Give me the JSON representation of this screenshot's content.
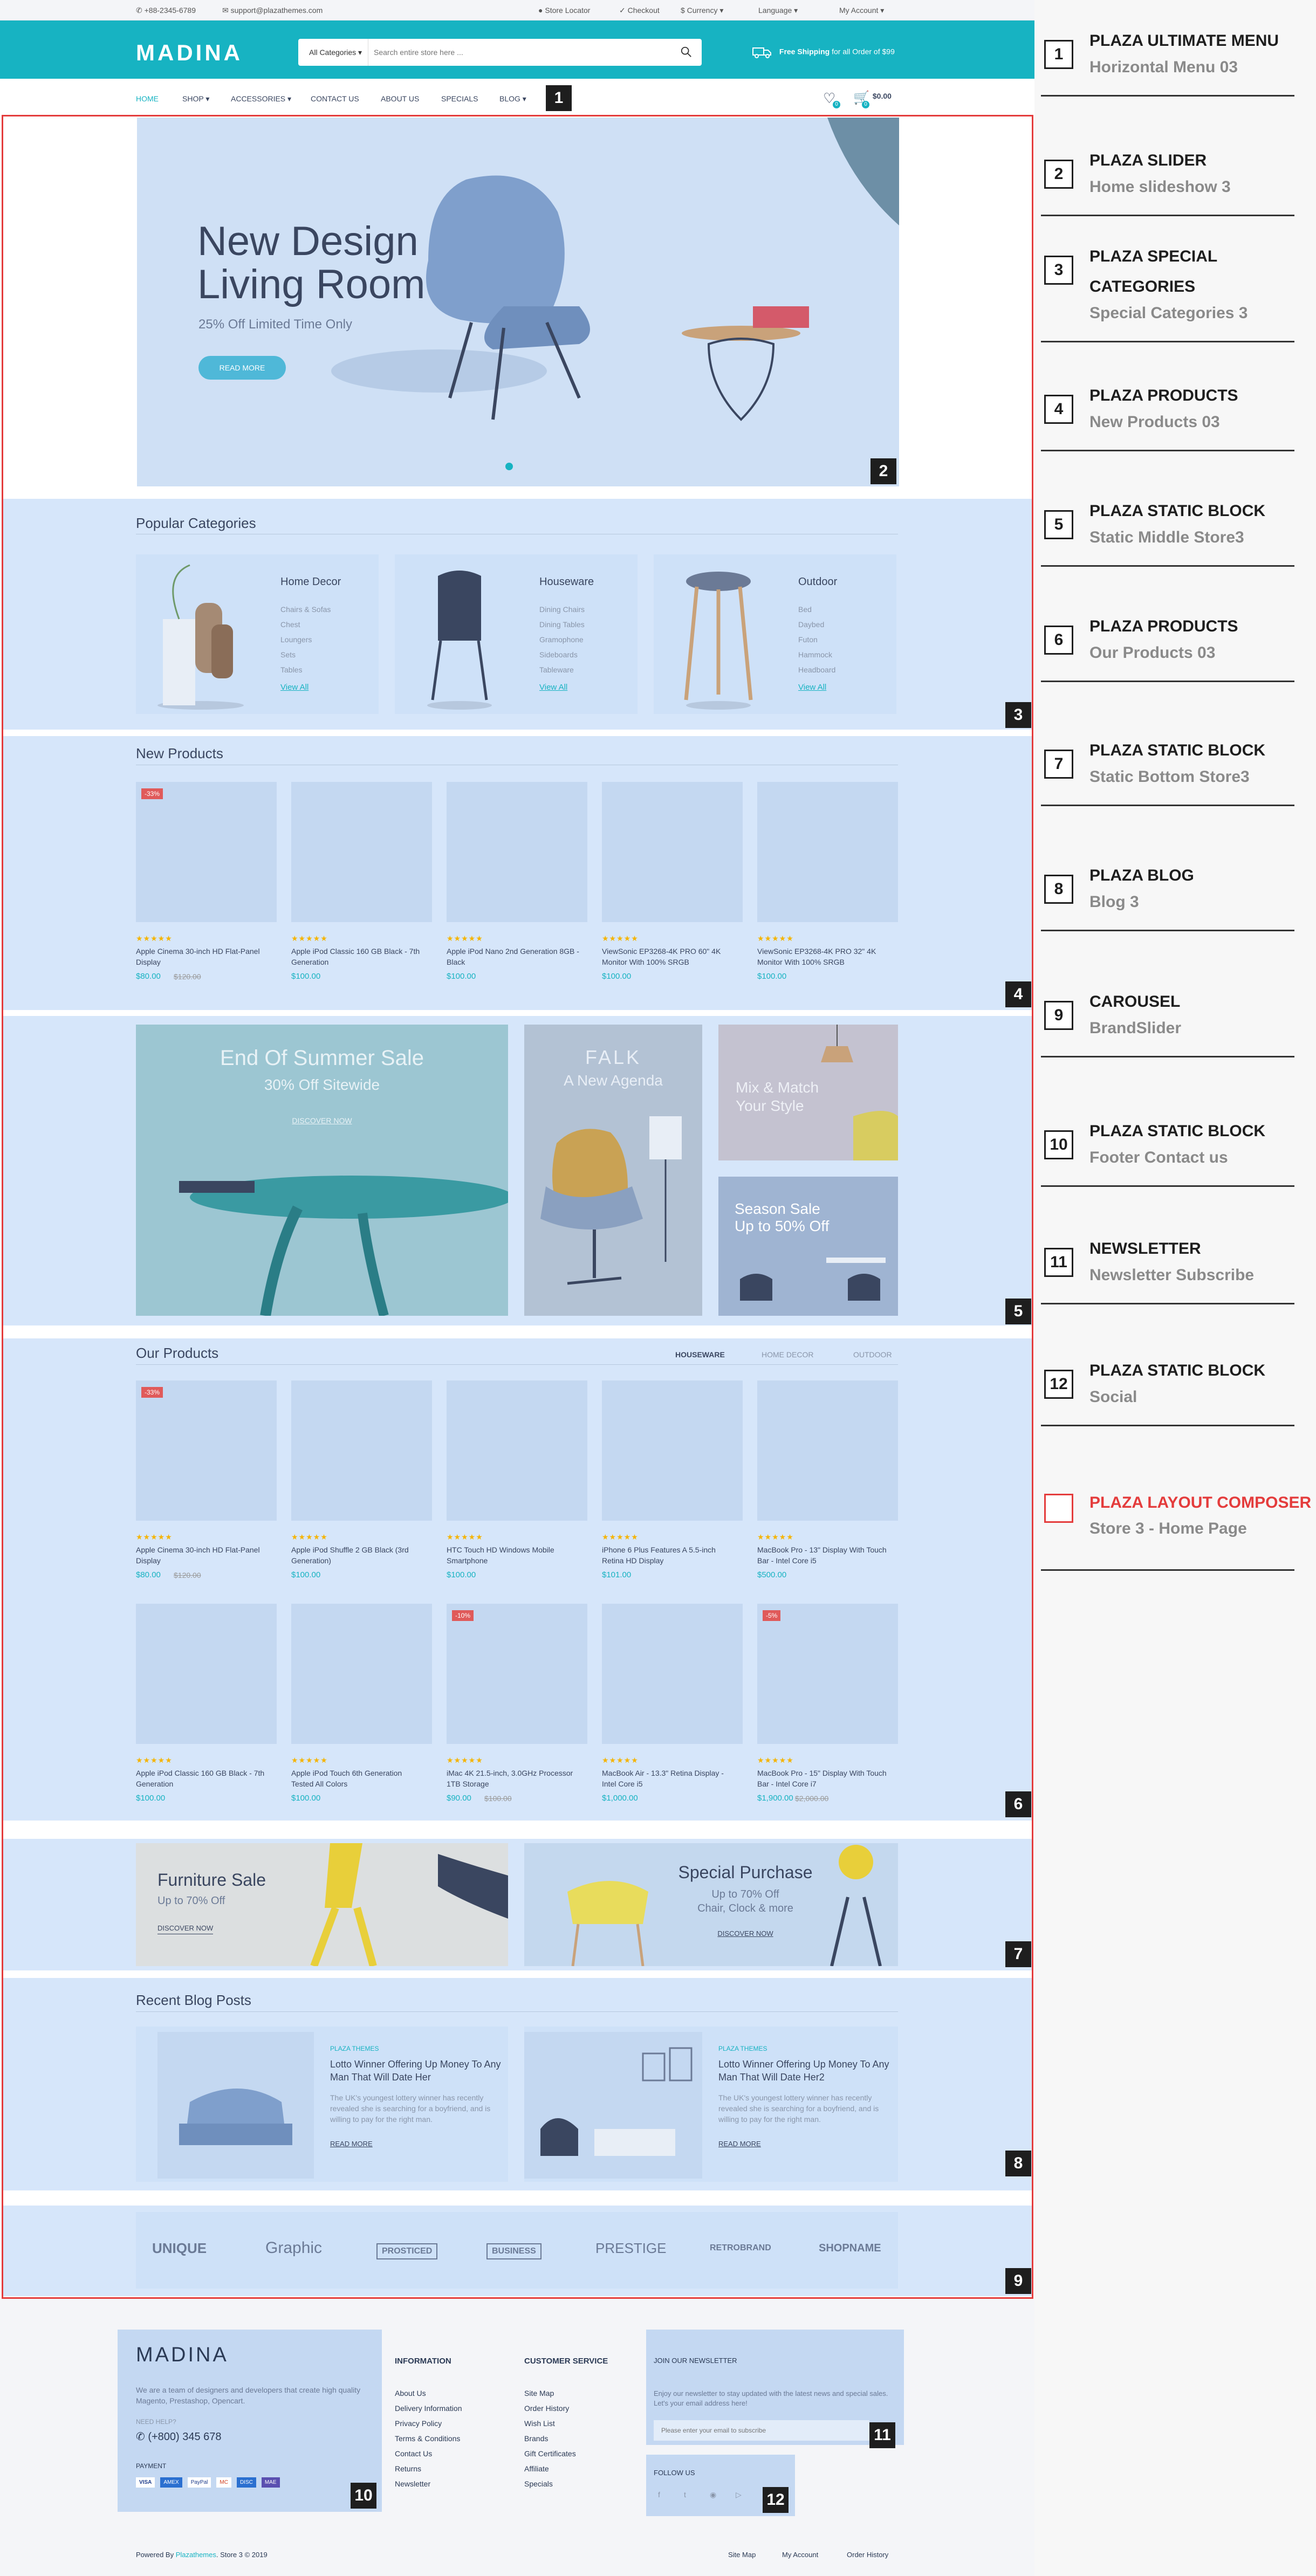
{
  "topbar": {
    "phone": "+88-2345-6789",
    "email": "support@plazathemes.com",
    "store_locator": "Store Locator",
    "checkout": "Checkout",
    "currency": "$ Currency",
    "language": "Language",
    "account": "My Account"
  },
  "header": {
    "logo": "MADINA",
    "category": "All Categories",
    "search_placeholder": "Search entire store here ...",
    "shipping_bold": "Free Shipping",
    "shipping_rest": "for all Order of $99"
  },
  "nav": {
    "items": [
      "HOME",
      "SHOP",
      "ACCESSORIES",
      "CONTACT US",
      "ABOUT US",
      "SPECIALS",
      "BLOG"
    ],
    "cart_total": "$0.00",
    "wishlist_count": "0",
    "cart_count": "0"
  },
  "slider": {
    "title_line1": "New Design",
    "title_line2": "Living Room",
    "subtitle": "25% Off Limited Time Only",
    "button": "READ MORE"
  },
  "popular": {
    "title": "Popular Categories",
    "cats": [
      {
        "name": "Home Decor",
        "links": [
          "Chairs & Sofas",
          "Chest",
          "Loungers",
          "Sets",
          "Tables"
        ],
        "view": "View All"
      },
      {
        "name": "Houseware",
        "links": [
          "Dining Chairs",
          "Dining Tables",
          "Gramophone",
          "Sideboards",
          "Tableware"
        ],
        "view": "View All"
      },
      {
        "name": "Outdoor",
        "links": [
          "Bed",
          "Daybed",
          "Futon",
          "Hammock",
          "Headboard"
        ],
        "view": "View All"
      }
    ]
  },
  "new_products": {
    "title": "New Products",
    "items": [
      {
        "name": "Apple Cinema 30-inch HD Flat-Panel Display",
        "price": "$80.00",
        "old": "$120.00",
        "sale": "-33%"
      },
      {
        "name": "Apple iPod Classic 160 GB Black - 7th Generation",
        "price": "$100.00",
        "old": "",
        "sale": ""
      },
      {
        "name": "Apple iPod Nano 2nd Generation 8GB - Black",
        "price": "$100.00",
        "old": "",
        "sale": ""
      },
      {
        "name": "ViewSonic EP3268-4K PRO 60\" 4K Monitor With 100% SRGB",
        "price": "$100.00",
        "old": "",
        "sale": ""
      },
      {
        "name": "ViewSonic EP3268-4K PRO 32\" 4K Monitor With 100% SRGB",
        "price": "$100.00",
        "old": "",
        "sale": ""
      }
    ]
  },
  "banners": {
    "summer_title": "End Of Summer Sale",
    "summer_sub": "30% Off Sitewide",
    "summer_btn": "DISCOVER NOW",
    "falk_title": "FALK",
    "falk_sub": "A New Agenda",
    "mix_title": "Mix & Match",
    "mix_sub": "Your Style",
    "season_title": "Season Sale",
    "season_sub": "Up to 50% Off"
  },
  "our_products": {
    "title": "Our Products",
    "tabs": [
      "HOUSEWARE",
      "HOME DECOR",
      "OUTDOOR"
    ],
    "items": [
      {
        "name": "Apple Cinema 30-inch HD Flat-Panel Display",
        "price": "$80.00",
        "old": "$120.00",
        "sale": "-33%"
      },
      {
        "name": "Apple iPod Shuffle 2 GB Black (3rd Generation)",
        "price": "$100.00",
        "old": "",
        "sale": ""
      },
      {
        "name": "HTC Touch HD Windows Mobile Smartphone",
        "price": "$100.00",
        "old": "",
        "sale": ""
      },
      {
        "name": "iPhone 6 Plus Features A 5.5-inch Retina HD Display",
        "price": "$101.00",
        "old": "",
        "sale": ""
      },
      {
        "name": "MacBook Pro - 13\" Display With Touch Bar - Intel Core i5",
        "price": "$500.00",
        "old": "",
        "sale": ""
      },
      {
        "name": "Apple iPod Classic 160 GB Black - 7th Generation",
        "price": "$100.00",
        "old": "",
        "sale": ""
      },
      {
        "name": "Apple iPod Touch 6th Generation Tested All Colors",
        "price": "$100.00",
        "old": "",
        "sale": ""
      },
      {
        "name": "iMac 4K 21.5-inch, 3.0GHz Processor 1TB Storage",
        "price": "$90.00",
        "old": "$100.00",
        "sale": "-10%"
      },
      {
        "name": "MacBook Air - 13.3\" Retina Display - Intel Core i5",
        "price": "$1,000.00",
        "old": "",
        "sale": ""
      },
      {
        "name": "MacBook Pro - 15\" Display With Touch Bar - Intel Core i7",
        "price": "$1,900.00",
        "old": "$2,000.00",
        "sale": "-5%"
      }
    ]
  },
  "static_bottom": {
    "furniture_title": "Furniture Sale",
    "furniture_sub": "Up to 70% Off",
    "furniture_btn": "DISCOVER NOW",
    "special_title": "Special Purchase",
    "special_sub1": "Up to 70% Off",
    "special_sub2": "Chair, Clock & more",
    "special_btn": "DISCOVER NOW"
  },
  "blog": {
    "title": "Recent Blog Posts",
    "posts": [
      {
        "tag": "PLAZA THEMES",
        "title": "Lotto Winner Offering Up Money To Any Man That Will Date Her",
        "excerpt": "The UK's youngest lottery winner has recently revealed she is searching for a boyfriend, and is willing to pay for the right man.",
        "more": "READ MORE"
      },
      {
        "tag": "PLAZA THEMES",
        "title": "Lotto Winner Offering Up Money To Any Man That Will Date Her2",
        "excerpt": "The UK's youngest lottery winner has recently revealed she is searching for a boyfriend, and is willing to pay for the right man.",
        "more": "READ MORE"
      }
    ]
  },
  "brands": [
    "UNIQUE",
    "Graphic",
    "PROSTICED",
    "BUSINESS",
    "PRESTIGE",
    "RETROBRAND",
    "SHOPNAME"
  ],
  "footer": {
    "logo": "MADINA",
    "about": "We are a team of designers and developers that create high quality Magento, Prestashop, Opencart.",
    "need_help": "NEED HELP?",
    "phone": "(+800) 345 678",
    "payment": "PAYMENT",
    "pay_icons": [
      "VISA",
      "AMEX",
      "PayPal",
      "MC",
      "DISC",
      "MAE"
    ],
    "info_title": "INFORMATION",
    "info_links": [
      "About Us",
      "Delivery Information",
      "Privacy Policy",
      "Terms & Conditions",
      "Contact Us",
      "Returns",
      "Newsletter"
    ],
    "cs_title": "CUSTOMER SERVICE",
    "cs_links": [
      "Site Map",
      "Order History",
      "Wish List",
      "Brands",
      "Gift Certificates",
      "Affiliate",
      "Specials"
    ],
    "newsletter_title": "JOIN OUR NEWSLETTER",
    "newsletter_text": "Enjoy our newsletter to stay updated with the latest news and special sales. Let's your email address here!",
    "newsletter_placeholder": "Please enter your email to subscribe",
    "follow": "FOLLOW US",
    "copyright_pre": "Powered By ",
    "copyright_brand": "Plazathemes",
    "copyright_post": ". Store 3 © 2019",
    "bottom_links": [
      "Site Map",
      "My Account",
      "Order History"
    ]
  },
  "modules": [
    {
      "num": "1",
      "title": "PLAZA ULTIMATE MENU",
      "sub": "Horizontal Menu 03"
    },
    {
      "num": "2",
      "title": "PLAZA SLIDER",
      "sub": "Home slideshow 3"
    },
    {
      "num": "3",
      "title": "PLAZA SPECIAL CATEGORIES",
      "sub": "Special Categories 3"
    },
    {
      "num": "4",
      "title": "PLAZA PRODUCTS",
      "sub": "New Products 03"
    },
    {
      "num": "5",
      "title": "PLAZA STATIC BLOCK",
      "sub": "Static Middle Store3"
    },
    {
      "num": "6",
      "title": "PLAZA PRODUCTS",
      "sub": "Our Products 03"
    },
    {
      "num": "7",
      "title": "PLAZA STATIC BLOCK",
      "sub": "Static Bottom Store3"
    },
    {
      "num": "8",
      "title": "PLAZA BLOG",
      "sub": "Blog 3"
    },
    {
      "num": "9",
      "title": "CAROUSEL",
      "sub": "BrandSlider"
    },
    {
      "num": "10",
      "title": "PLAZA STATIC BLOCK",
      "sub": "Footer Contact us"
    },
    {
      "num": "11",
      "title": "NEWSLETTER",
      "sub": "Newsletter Subscribe"
    },
    {
      "num": "12",
      "title": "PLAZA STATIC BLOCK",
      "sub": "Social"
    }
  ],
  "composer": {
    "title": "PLAZA LAYOUT COMPOSER",
    "sub": "Store 3 - Home Page"
  },
  "colors": {
    "accent": "#17b3c2",
    "overlay": "#a5c8f5",
    "frame": "#e43c3c"
  }
}
